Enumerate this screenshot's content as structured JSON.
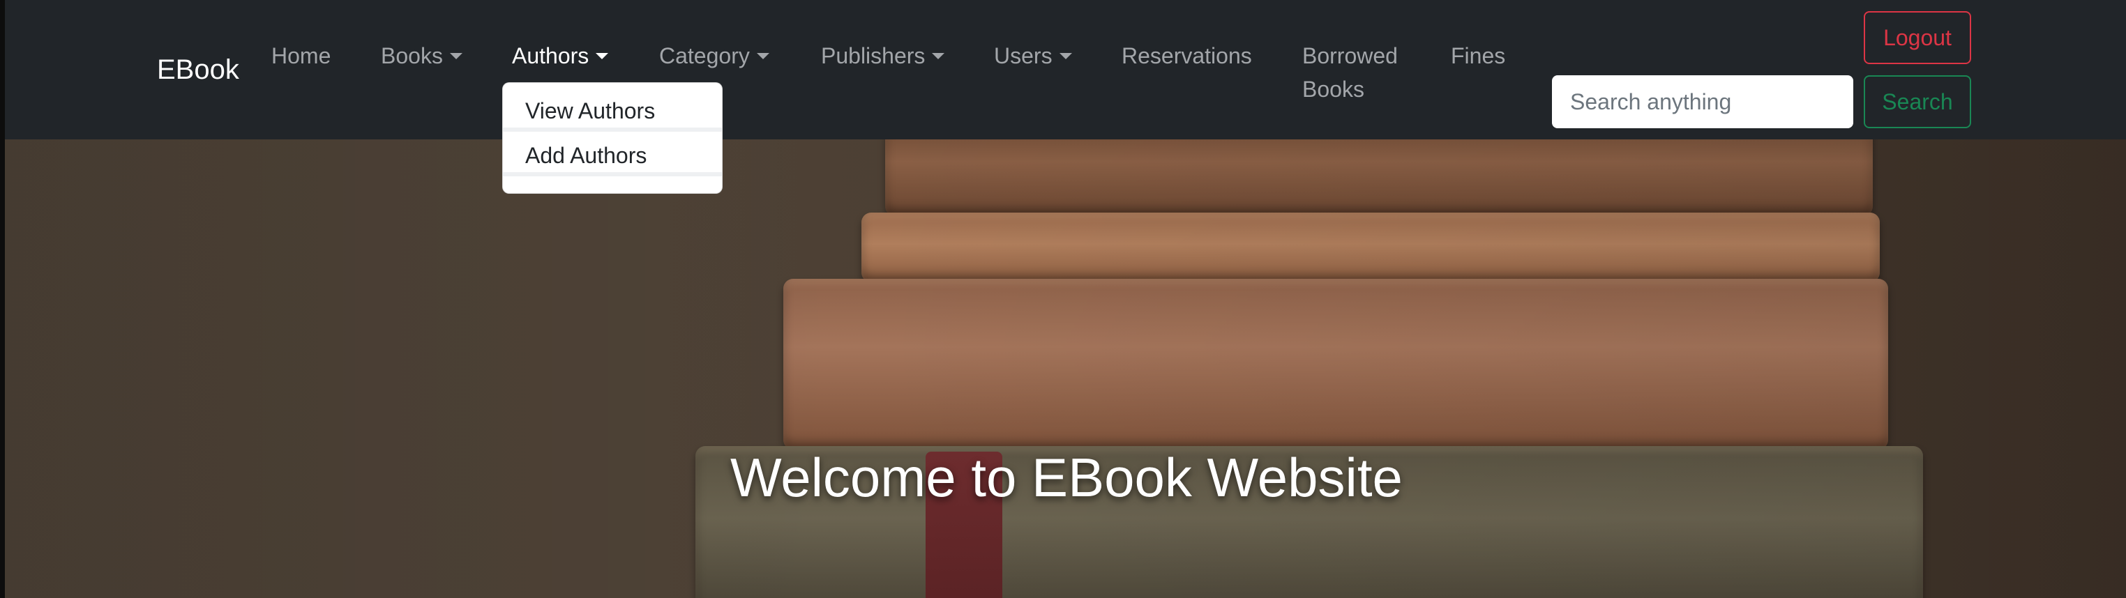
{
  "brand": "EBook",
  "nav": {
    "home": "Home",
    "books": "Books",
    "authors": "Authors",
    "category": "Category",
    "publishers": "Publishers",
    "users": "Users",
    "reservations": "Reservations",
    "borrowed_books": "Borrowed Books",
    "fines": "Fines"
  },
  "authors_dropdown": {
    "items": [
      "View Authors",
      "Add Authors"
    ]
  },
  "search": {
    "placeholder": "Search anything",
    "value": "",
    "button_label": "Search"
  },
  "logout_label": "Logout",
  "hero": {
    "title": "Welcome to EBook Website"
  },
  "colors": {
    "navbar_bg": "#212529",
    "danger": "#dc3545",
    "success": "#198754"
  },
  "icons": {
    "dropdown_caret": "caret-down-icon"
  }
}
